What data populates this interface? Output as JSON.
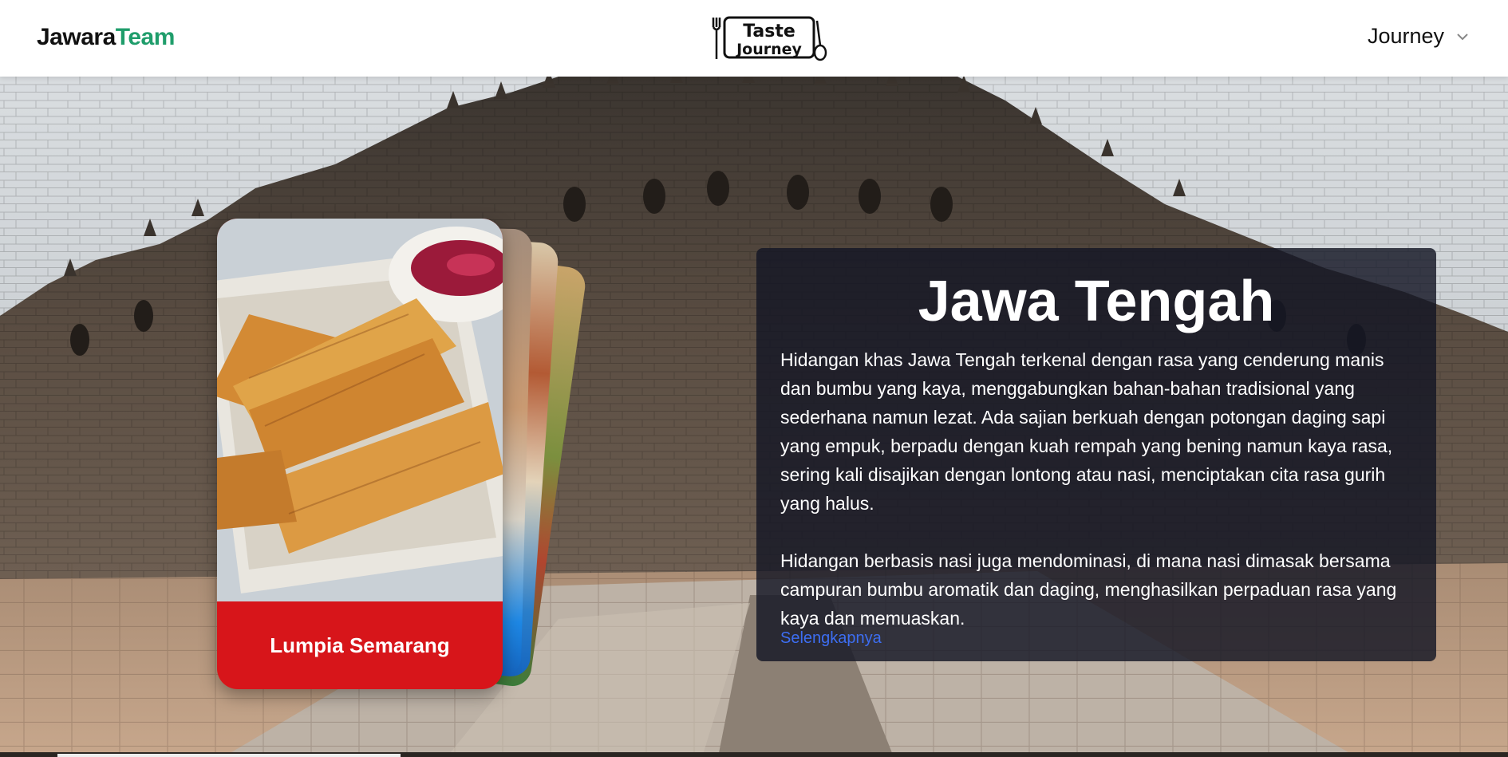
{
  "header": {
    "brand_part1": "Jawara",
    "brand_part2": "Team",
    "logo_line1": "Taste",
    "logo_line2": "Journey",
    "nav_label": "Journey",
    "nav_icon": "chevron-down-icon"
  },
  "card": {
    "caption": "Lumpia Semarang",
    "caption_bg": "#d7151a"
  },
  "panel": {
    "title": "Jawa Tengah",
    "paragraph1": "Hidangan khas Jawa Tengah terkenal dengan rasa yang cenderung manis dan bumbu yang kaya, menggabungkan bahan-bahan tradisional yang sederhana namun lezat. Ada sajian berkuah dengan potongan daging sapi yang empuk, berpadu dengan kuah rempah yang bening namun kaya rasa, sering kali disajikan dengan lontong atau nasi, menciptakan cita rasa gurih yang halus.",
    "paragraph2": "Hidangan berbasis nasi juga mendominasi, di mana nasi dimasak bersama campuran bumbu aromatik dan daging, menghasilkan perpaduan rasa yang kaya dan memuaskan.",
    "link": "Selengkapnya"
  },
  "colors": {
    "brand_green": "#1f9d6b",
    "link_blue": "#3d6ef2",
    "panel_bg": "#14162499"
  }
}
